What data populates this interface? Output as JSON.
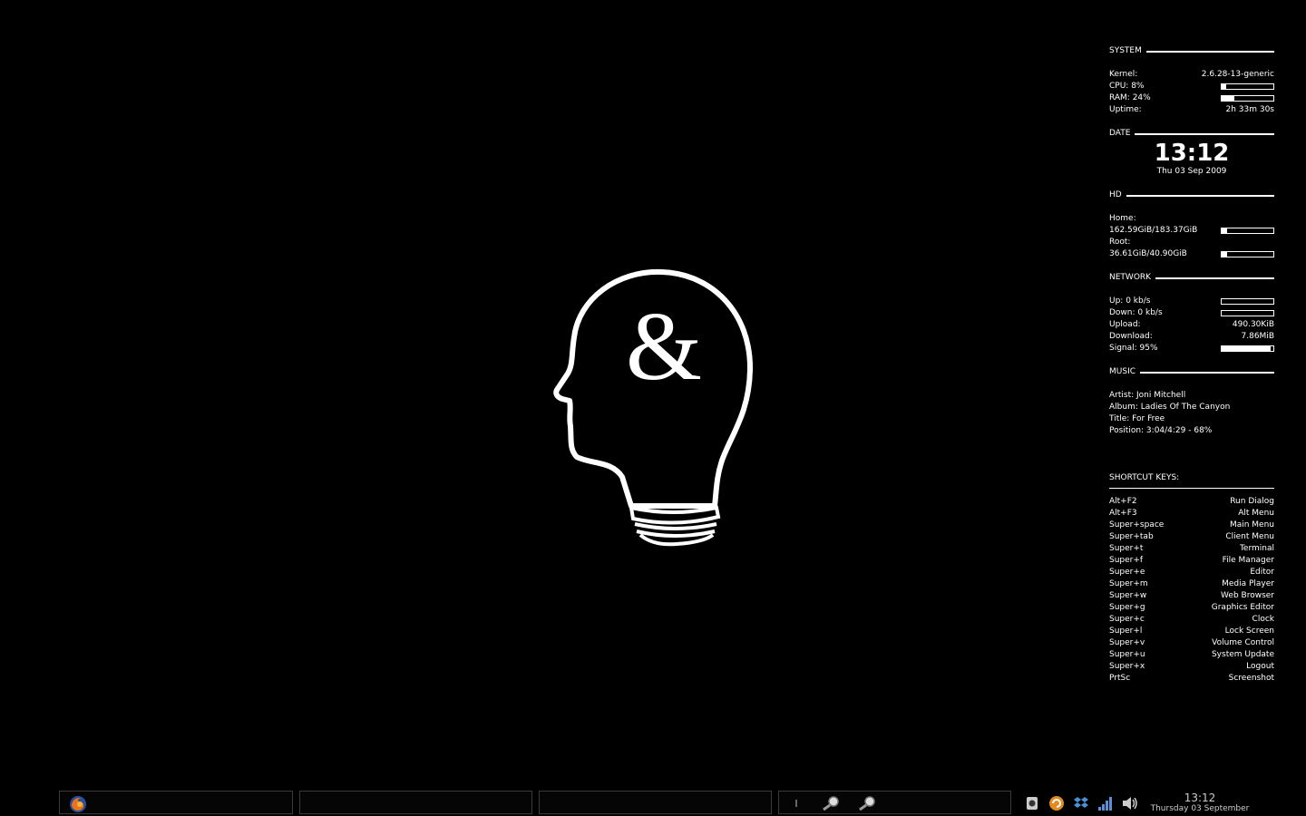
{
  "system": {
    "heading": "SYSTEM",
    "kernel_label": "Kernel:",
    "kernel_value": "2.6.28-13-generic",
    "cpu_label": "CPU: 8%",
    "cpu_percent": 8,
    "ram_label": "RAM: 24%",
    "ram_percent": 24,
    "uptime_label": "Uptime:",
    "uptime_value": "2h 33m 30s"
  },
  "date": {
    "heading": "DATE",
    "time": "13:12",
    "date": "Thu 03 Sep 2009"
  },
  "hd": {
    "heading": "HD",
    "home_label": "Home:",
    "home_usage": "162.59GiB/183.37GiB",
    "home_percent": 11,
    "root_label": "Root:",
    "root_usage": "36.61GiB/40.90GiB",
    "root_percent": 10
  },
  "network": {
    "heading": "NETWORK",
    "up_label": "Up: 0 kb/s",
    "down_label": "Down: 0 kb/s",
    "upload_label": "Upload:",
    "upload_value": "490.30KiB",
    "download_label": "Download:",
    "download_value": "7.86MiB",
    "signal_label": "Signal: 95%",
    "signal_percent": 95
  },
  "music": {
    "heading": "MUSIC",
    "artist": "Artist: Joni Mitchell",
    "album": "Album: Ladies Of The Canyon",
    "title": "Title: For Free",
    "position": "Position: 3:04/4:29 - 68%"
  },
  "shortcuts": {
    "heading": "SHORTCUT KEYS:",
    "items": [
      {
        "key": "Alt+F2",
        "action": "Run Dialog"
      },
      {
        "key": "Alt+F3",
        "action": "Alt Menu"
      },
      {
        "key": "Super+space",
        "action": "Main Menu"
      },
      {
        "key": "Super+tab",
        "action": "Client Menu"
      },
      {
        "key": "Super+t",
        "action": "Terminal"
      },
      {
        "key": "Super+f",
        "action": "File Manager"
      },
      {
        "key": "Super+e",
        "action": "Editor"
      },
      {
        "key": "Super+m",
        "action": "Media Player"
      },
      {
        "key": "Super+w",
        "action": "Web Browser"
      },
      {
        "key": "Super+g",
        "action": "Graphics Editor"
      },
      {
        "key": "Super+c",
        "action": "Clock"
      },
      {
        "key": "Super+l",
        "action": "Lock Screen"
      },
      {
        "key": "Super+v",
        "action": "Volume Control"
      },
      {
        "key": "Super+u",
        "action": "System Update"
      },
      {
        "key": "Super+x",
        "action": "Logout"
      },
      {
        "key": "PrtSc",
        "action": "Screenshot"
      }
    ]
  },
  "wallpaper": {
    "symbol": "&",
    "icon": "head-lightbulb-logo"
  },
  "taskbar": {
    "time": "13:12",
    "date": "Thursday 03 September",
    "launcher_icon": "firefox-icon",
    "tray_icons": [
      "notes-icon",
      "update-icon",
      "dropbox-icon",
      "network-signal-icon",
      "volume-icon"
    ]
  }
}
